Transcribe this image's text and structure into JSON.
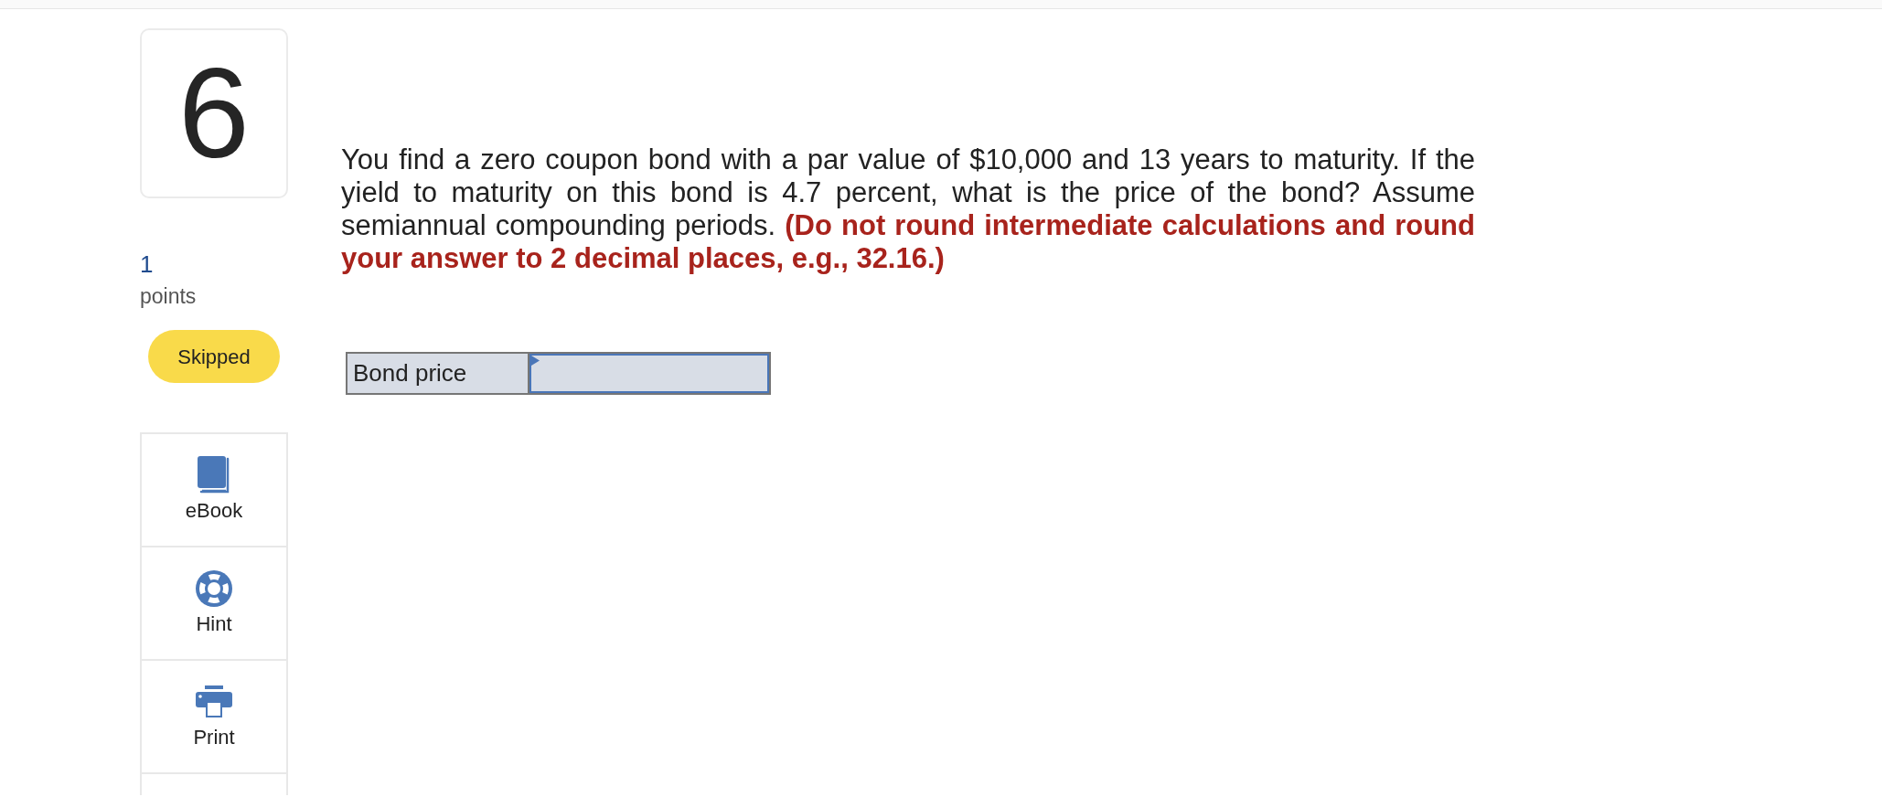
{
  "question": {
    "number": "6",
    "points": "1",
    "points_label": "points",
    "status": "Skipped"
  },
  "tools": [
    {
      "kind": "ebook",
      "label": "eBook"
    },
    {
      "kind": "hint",
      "label": "Hint"
    },
    {
      "kind": "print",
      "label": "Print"
    }
  ],
  "prompt": "You find a zero coupon bond with a par value of $10,000 and 13 years to maturity. If the yield to maturity on this bond is 4.7 percent, what is the price of the bond? Assume semiannual compounding periods. **(Do not round intermediate calculations and round your answer to 2 decimal places, e.g., 32.16.)**",
  "answer_table": {
    "rows": [
      {
        "label": "Bond price"
      }
    ]
  }
}
